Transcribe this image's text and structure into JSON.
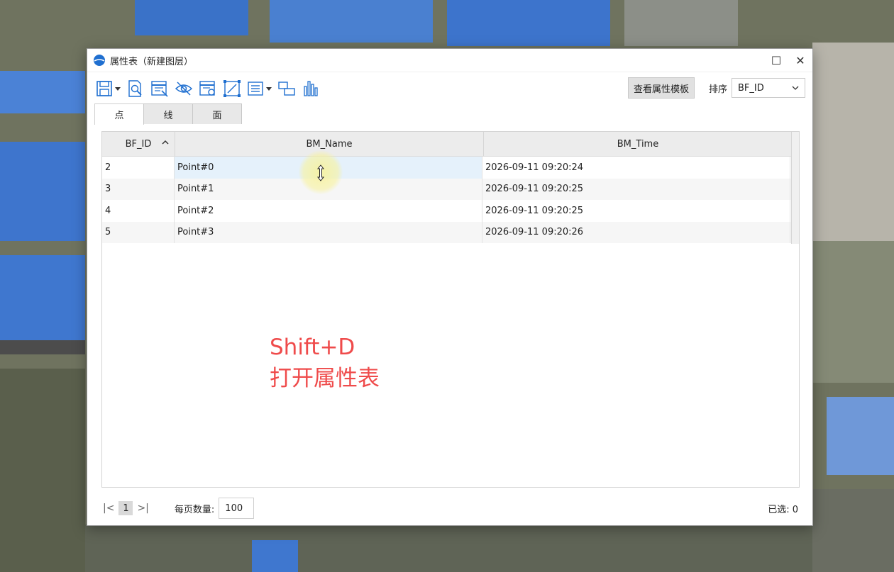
{
  "window": {
    "title": "属性表（新建图层）",
    "maximize_glyph": "☐",
    "close_glyph": "✕"
  },
  "toolbar": {
    "icons": [
      "save-icon",
      "query-icon",
      "field-calc-icon",
      "hide-icon",
      "attr-icon",
      "select-geom-icon",
      "list-icon",
      "layout-icon",
      "chart-icon"
    ],
    "template_button": "查看属性模板",
    "sort_label": "排序",
    "sort_value": "BF_ID"
  },
  "tabs": [
    {
      "label": "点",
      "active": true
    },
    {
      "label": "线",
      "active": false
    },
    {
      "label": "面",
      "active": false
    }
  ],
  "table": {
    "columns": [
      "BF_ID",
      "BM_Name",
      "BM_Time"
    ],
    "rows": [
      [
        "2",
        "Point#0",
        "2026-09-11 09:20:24"
      ],
      [
        "3",
        "Point#1",
        "2026-09-11 09:20:25"
      ],
      [
        "4",
        "Point#2",
        "2026-09-11 09:20:25"
      ],
      [
        "5",
        "Point#3",
        "2026-09-11 09:20:26"
      ]
    ]
  },
  "overlay": {
    "line1": "Shift+D",
    "line2": "打开属性表",
    "color": "#ef4b4b"
  },
  "pager": {
    "first": "|<",
    "current_page": "1",
    "last": ">|",
    "page_size_label": "每页数量:",
    "page_size": "100",
    "selected_label": "已选: 0"
  }
}
